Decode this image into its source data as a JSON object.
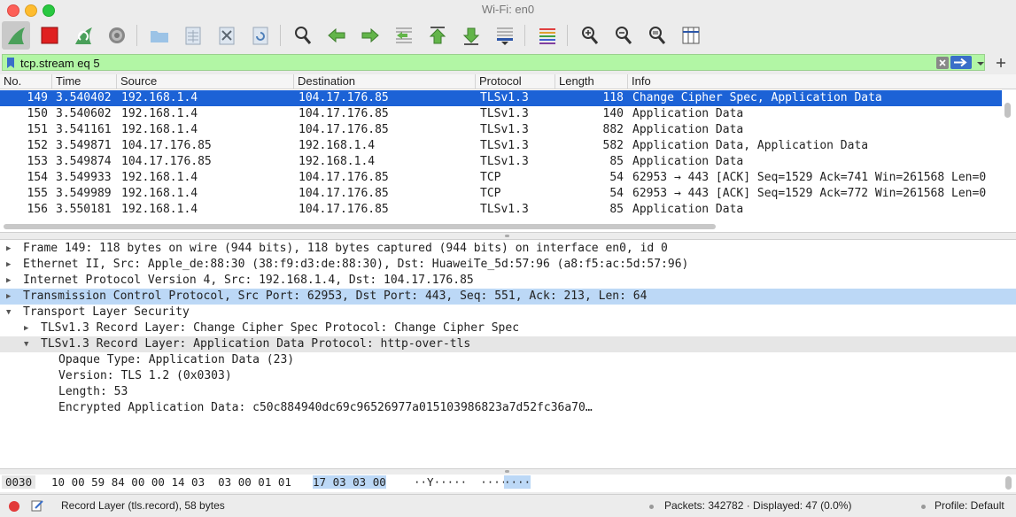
{
  "window": {
    "title": "Wi-Fi: en0"
  },
  "filter": {
    "value": "tcp.stream eq 5"
  },
  "columns": [
    "No.",
    "Time",
    "Source",
    "Destination",
    "Protocol",
    "Length",
    "Info"
  ],
  "packets": [
    {
      "no": "149",
      "time": "3.540402",
      "src": "192.168.1.4",
      "dst": "104.17.176.85",
      "proto": "TLSv1.3",
      "len": "118",
      "info": "Change Cipher Spec, Application Data"
    },
    {
      "no": "150",
      "time": "3.540602",
      "src": "192.168.1.4",
      "dst": "104.17.176.85",
      "proto": "TLSv1.3",
      "len": "140",
      "info": "Application Data"
    },
    {
      "no": "151",
      "time": "3.541161",
      "src": "192.168.1.4",
      "dst": "104.17.176.85",
      "proto": "TLSv1.3",
      "len": "882",
      "info": "Application Data"
    },
    {
      "no": "152",
      "time": "3.549871",
      "src": "104.17.176.85",
      "dst": "192.168.1.4",
      "proto": "TLSv1.3",
      "len": "582",
      "info": "Application Data, Application Data"
    },
    {
      "no": "153",
      "time": "3.549874",
      "src": "104.17.176.85",
      "dst": "192.168.1.4",
      "proto": "TLSv1.3",
      "len": "85",
      "info": "Application Data"
    },
    {
      "no": "154",
      "time": "3.549933",
      "src": "192.168.1.4",
      "dst": "104.17.176.85",
      "proto": "TCP",
      "len": "54",
      "info": "62953 → 443 [ACK] Seq=1529 Ack=741 Win=261568 Len=0"
    },
    {
      "no": "155",
      "time": "3.549989",
      "src": "192.168.1.4",
      "dst": "104.17.176.85",
      "proto": "TCP",
      "len": "54",
      "info": "62953 → 443 [ACK] Seq=1529 Ack=772 Win=261568 Len=0"
    },
    {
      "no": "156",
      "time": "3.550181",
      "src": "192.168.1.4",
      "dst": "104.17.176.85",
      "proto": "TLSv1.3",
      "len": "85",
      "info": "Application Data"
    }
  ],
  "details": [
    {
      "text": "Frame 149: 118 bytes on wire (944 bits), 118 bytes captured (944 bits) on interface en0, id 0",
      "indent": 0,
      "arrow": "right"
    },
    {
      "text": "Ethernet II, Src: Apple_de:88:30 (38:f9:d3:de:88:30), Dst: HuaweiTe_5d:57:96 (a8:f5:ac:5d:57:96)",
      "indent": 0,
      "arrow": "right"
    },
    {
      "text": "Internet Protocol Version 4, Src: 192.168.1.4, Dst: 104.17.176.85",
      "indent": 0,
      "arrow": "right"
    },
    {
      "text": "Transmission Control Protocol, Src Port: 62953, Dst Port: 443, Seq: 551, Ack: 213, Len: 64",
      "indent": 0,
      "arrow": "right"
    },
    {
      "text": "Transport Layer Security",
      "indent": 0,
      "arrow": "down"
    },
    {
      "text": "TLSv1.3 Record Layer: Change Cipher Spec Protocol: Change Cipher Spec",
      "indent": 1,
      "arrow": "right"
    },
    {
      "text": "TLSv1.3 Record Layer: Application Data Protocol: http-over-tls",
      "indent": 1,
      "arrow": "down"
    },
    {
      "text": "Opaque Type: Application Data (23)",
      "indent": 2,
      "arrow": "none"
    },
    {
      "text": "Version: TLS 1.2 (0x0303)",
      "indent": 2,
      "arrow": "none"
    },
    {
      "text": "Length: 53",
      "indent": 2,
      "arrow": "none"
    },
    {
      "text": "Encrypted Application Data: c50c884940dc69c96526977a015103986823a7d52fc36a70…",
      "indent": 2,
      "arrow": "none"
    }
  ],
  "bytes": {
    "offset": "0030",
    "hex_a": "10 00 59 84 00 00 14 03  03 00 01 01",
    "hex_b": "17 03 03 00",
    "ascii_a": "··Y·····  ····",
    "ascii_b": "····"
  },
  "status": {
    "field": "Record Layer (tls.record), 58 bytes",
    "packets": "Packets: 342782 · Displayed: 47 (0.0%)",
    "profile": "Profile: Default"
  },
  "colors": {
    "selected": "#1c62d6",
    "highlight": "#bcd8f6",
    "filter_bg": "#b2f6a5",
    "expanded": "#e6e6e6"
  }
}
